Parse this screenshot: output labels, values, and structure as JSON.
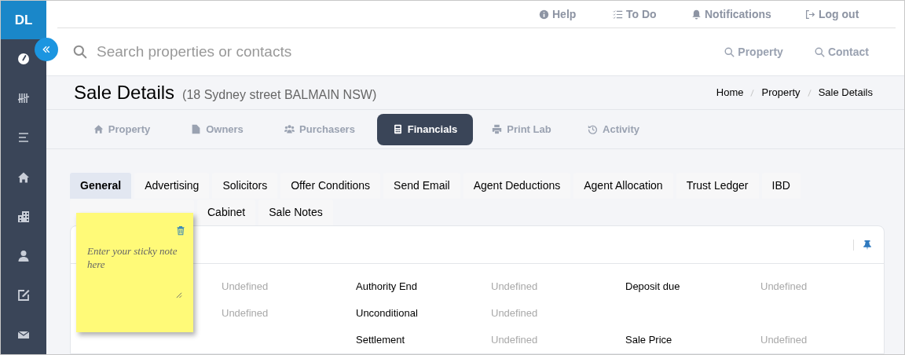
{
  "app": {
    "initials": "DL"
  },
  "sidebar": {
    "items": [
      {
        "selected": true
      },
      {
        "selected": false
      },
      {
        "selected": false
      },
      {
        "selected": false
      },
      {
        "selected": false
      },
      {
        "selected": false
      },
      {
        "selected": false
      },
      {
        "selected": false
      }
    ]
  },
  "top_links": [
    {
      "label": "Help"
    },
    {
      "label": "To Do"
    },
    {
      "label": "Notifications"
    },
    {
      "label": "Log out"
    }
  ],
  "search": {
    "placeholder": "Search properties or contacts",
    "scopes": [
      "Property",
      "Contact"
    ]
  },
  "page": {
    "title": "Sale Details",
    "subtitle": "(18 Sydney street BALMAIN NSW)",
    "breadcrumbs": [
      "Home",
      "Property",
      "Sale Details"
    ]
  },
  "main_tabs": [
    {
      "label": "Property",
      "selected": false
    },
    {
      "label": "Owners",
      "selected": false
    },
    {
      "label": "Purchasers",
      "selected": false
    },
    {
      "label": "Financials",
      "selected": true
    },
    {
      "label": "Print Lab",
      "selected": false
    },
    {
      "label": "Activity",
      "selected": false
    }
  ],
  "sub_tabs": [
    [
      {
        "label": "General",
        "selected": true
      },
      {
        "label": "Advertising",
        "selected": false
      },
      {
        "label": "Solicitors",
        "selected": false
      },
      {
        "label": "Offer Conditions",
        "selected": false
      },
      {
        "label": "Send Email",
        "selected": false
      },
      {
        "label": "Agent Deductions",
        "selected": false
      },
      {
        "label": "Agent Allocation",
        "selected": false
      },
      {
        "label": "Trust Ledger",
        "selected": false
      },
      {
        "label": "IBD",
        "selected": false
      }
    ],
    [
      {
        "label": "Cabinet",
        "selected": false
      },
      {
        "label": "Sale Notes",
        "selected": false
      }
    ]
  ],
  "details": {
    "rows": [
      [
        {
          "value": "Undefined"
        },
        {
          "label": "Authority End",
          "value": "Undefined"
        },
        {
          "label": "Deposit due",
          "value": "Undefined"
        }
      ],
      [
        {
          "value": "Undefined"
        },
        {
          "label": "Unconditional",
          "value": "Undefined"
        },
        {}
      ],
      [
        {},
        {
          "label": "Settlement",
          "value": "Undefined"
        },
        {
          "label": "Sale Price",
          "value": "Undefined"
        }
      ]
    ]
  },
  "sticky_note": {
    "placeholder": "Enter your sticky note here"
  }
}
